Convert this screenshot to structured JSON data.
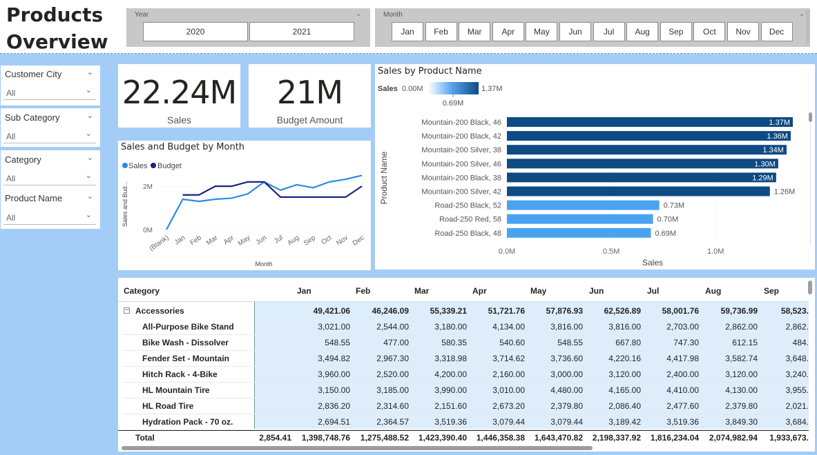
{
  "page": {
    "title_line1": "Products",
    "title_line2": "Overview"
  },
  "year_slicer": {
    "label": "Year",
    "options": [
      "2020",
      "2021"
    ]
  },
  "month_slicer": {
    "label": "Month",
    "options": [
      "Jan",
      "Feb",
      "Mar",
      "Apr",
      "May",
      "Jun",
      "Jul",
      "Aug",
      "Sep",
      "Oct",
      "Nov",
      "Dec"
    ]
  },
  "filters": [
    {
      "label": "Customer City",
      "value": "All"
    },
    {
      "label": "Sub Category",
      "value": "All"
    },
    {
      "label": "Category",
      "value": "All"
    },
    {
      "label": "Product Name",
      "value": "All"
    }
  ],
  "kpis": {
    "sales_value": "22.24M",
    "sales_label": "Sales",
    "budget_value": "21M",
    "budget_label": "Budget Amount"
  },
  "line_chart": {
    "title": "Sales and Budget by Month",
    "legend": [
      "Sales",
      "Budget"
    ],
    "ylabel": "Sales and Bud...",
    "xlabel": "Month",
    "yticks": [
      "0M",
      "2M"
    ],
    "colors": {
      "sales": "#2b8ae6",
      "budget": "#1a237e"
    }
  },
  "bar_chart": {
    "title": "Sales by Product Name",
    "legend_label": "Sales",
    "gradient_min": "0.00M",
    "gradient_max": "1.37M",
    "gradient_mid": "0.69M",
    "ylabel": "Product Name",
    "xlabel": "Sales",
    "xticks": [
      "0.0M",
      "0.5M",
      "1.0M"
    ],
    "colors": {
      "high": "#0e4a84",
      "low": "#4aa3f0"
    }
  },
  "chart_data": [
    {
      "type": "line",
      "title": "Sales and Budget by Month",
      "xlabel": "Month",
      "ylabel": "Sales and Bud...",
      "categories": [
        "(Blank)",
        "Jan",
        "Feb",
        "Mar",
        "Apr",
        "May",
        "Jun",
        "Jul",
        "Aug",
        "Sep",
        "Oct",
        "Nov",
        "Dec"
      ],
      "series": [
        {
          "name": "Sales",
          "values": [
            0.0,
            1.4,
            1.3,
            1.4,
            1.45,
            1.65,
            2.2,
            1.82,
            2.07,
            1.93,
            2.2,
            2.32,
            2.5
          ]
        },
        {
          "name": "Budget",
          "values": [
            null,
            1.6,
            1.6,
            2.0,
            2.0,
            2.2,
            2.2,
            1.5,
            1.5,
            1.5,
            1.5,
            1.5,
            2.0
          ]
        }
      ],
      "ylim": [
        0,
        2.8
      ],
      "legend": "top-left"
    },
    {
      "type": "bar",
      "title": "Sales by Product Name",
      "xlabel": "Sales",
      "ylabel": "Product Name",
      "categories": [
        "Mountain-200 Black, 46",
        "Mountain-200 Black, 42",
        "Mountain-200 Silver, 38",
        "Mountain-200 Silver, 46",
        "Mountain-200 Black, 38",
        "Mountain-200 Silver, 42",
        "Road-250 Black, 52",
        "Road-250 Red, 58",
        "Road-250 Black, 48"
      ],
      "values": [
        1.37,
        1.36,
        1.34,
        1.3,
        1.29,
        1.26,
        0.73,
        0.7,
        0.69
      ],
      "value_labels": [
        "1.37M",
        "1.36M",
        "1.34M",
        "1.30M",
        "1.29M",
        "1.26M",
        "0.73M",
        "0.70M",
        "0.69M"
      ],
      "xlim": [
        0,
        1.37
      ]
    }
  ],
  "matrix": {
    "row_header": "Category",
    "columns": [
      "Jan",
      "Feb",
      "Mar",
      "Apr",
      "May",
      "Jun",
      "Jul",
      "Aug",
      "Sep"
    ],
    "group": {
      "name": "Accessories",
      "collapse_icon": "minus-box",
      "values": [
        "49,421.06",
        "46,246.09",
        "55,339.21",
        "51,721.76",
        "57,876.93",
        "62,526.89",
        "58,001.76",
        "59,736.99",
        "58,523."
      ]
    },
    "rows": [
      {
        "name": "All-Purpose Bike Stand",
        "values": [
          "3,021.00",
          "2,544.00",
          "3,180.00",
          "4,134.00",
          "3,816.00",
          "3,816.00",
          "2,703.00",
          "2,862.00",
          "2,862."
        ]
      },
      {
        "name": "Bike Wash - Dissolver",
        "values": [
          "548.55",
          "477.00",
          "580.35",
          "540.60",
          "548.55",
          "667.80",
          "747.30",
          "612.15",
          "484."
        ]
      },
      {
        "name": "Fender Set - Mountain",
        "values": [
          "3,494.82",
          "2,967.30",
          "3,318.98",
          "3,714.62",
          "3,736.60",
          "4,220.16",
          "4,417.98",
          "3,582.74",
          "3,648."
        ]
      },
      {
        "name": "Hitch Rack - 4-Bike",
        "values": [
          "3,960.00",
          "2,520.00",
          "4,200.00",
          "2,160.00",
          "3,000.00",
          "3,120.00",
          "2,400.00",
          "3,120.00",
          "3,240."
        ]
      },
      {
        "name": "HL Mountain Tire",
        "values": [
          "3,150.00",
          "3,185.00",
          "3,990.00",
          "3,010.00",
          "4,480.00",
          "4,165.00",
          "4,410.00",
          "4,130.00",
          "3,955."
        ]
      },
      {
        "name": "HL Road Tire",
        "values": [
          "2,836.20",
          "2,314.60",
          "2,151.60",
          "2,673.20",
          "2,379.80",
          "2,086.40",
          "2,477.60",
          "2,379.80",
          "2,021."
        ]
      },
      {
        "name": "Hydration Pack - 70 oz.",
        "values": [
          "2,694.51",
          "2,364.57",
          "3,519.36",
          "3,079.44",
          "3,079.44",
          "3,189.42",
          "3,519.36",
          "3,849.30",
          "3,684."
        ]
      }
    ],
    "total": {
      "name": "Total",
      "first": "2,854.41",
      "values": [
        "1,398,748.76",
        "1,275,488.52",
        "1,423,390.40",
        "1,446,358.38",
        "1,643,470.82",
        "2,198,337.92",
        "1,816,234.04",
        "2,074,982.94",
        "1,933,673."
      ]
    }
  }
}
